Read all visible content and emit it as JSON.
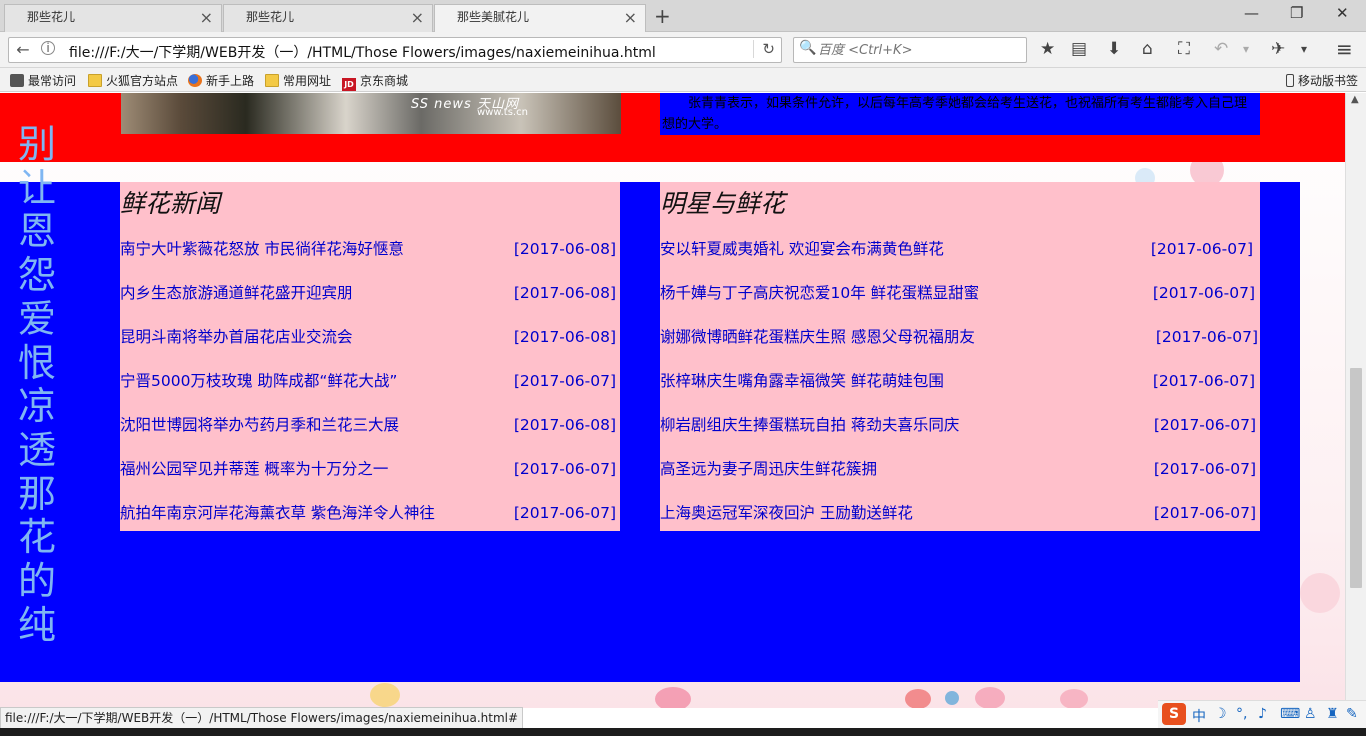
{
  "tabs": [
    {
      "title": "那些花儿",
      "close": "×"
    },
    {
      "title": "那些花儿",
      "close": "×"
    },
    {
      "title": "那些美腻花儿",
      "close": "×"
    }
  ],
  "newtab": "+",
  "window": {
    "minimize": "—",
    "restore": "❐",
    "close": "✕"
  },
  "nav": {
    "back": "←",
    "info": "i",
    "url": "file:///F:/大一/下学期/WEB开发（一）/HTML/Those Flowers/images/naxiemeinihua.html",
    "reload": "↻",
    "search_placeholder": "百度 <Ctrl+K>",
    "search_icon": "🔍"
  },
  "toolbar_icons": [
    "★",
    "▤",
    "⬇",
    "⌂",
    "⛶",
    "↶",
    "▾",
    "✈",
    "▾",
    "≡"
  ],
  "bookmarks": [
    {
      "label": "最常访问",
      "icon": "gear-icon"
    },
    {
      "label": "火狐官方站点",
      "icon": "folder-icon"
    },
    {
      "label": "新手上路",
      "icon": "firefox-icon"
    },
    {
      "label": "常用网址",
      "icon": "folder-icon"
    },
    {
      "label": "京东商城",
      "icon": "jd-icon"
    }
  ],
  "jd_badge": "JD",
  "mobile_bookmarks": "移动版书签",
  "page": {
    "banner_logo": "SS news 天山网",
    "banner_site": "www.ts.cn",
    "top_paragraph": "张青青表示，如果条件允许，以后每年高考季她都会给考生送花，也祝福所有考生都能考入自己理想的大学。",
    "vertical_text": "别让恩怨爱恨 凉透那花的纯",
    "left_panel": {
      "title": "鲜花新闻",
      "items": [
        {
          "text": "南宁大叶紫薇花怒放  市民徜徉花海好惬意",
          "date": "[2017-06-08]"
        },
        {
          "text": "内乡生态旅游通道鲜花盛开迎宾朋",
          "date": "[2017-06-08]"
        },
        {
          "text": "昆明斗南将举办首届花店业交流会",
          "date": "[2017-06-08]"
        },
        {
          "text": "宁晋5000万枝玫瑰  助阵成都“鲜花大战”",
          "date": "[2017-06-07]"
        },
        {
          "text": "沈阳世博园将举办芍药月季和兰花三大展",
          "date": "[2017-06-08]"
        },
        {
          "text": "福州公园罕见并蒂莲  概率为十万分之一",
          "date": "[2017-06-07]"
        },
        {
          "text": "航拍年南京河岸花海薰衣草  紫色海洋令人神往",
          "date": "[2017-06-07]"
        }
      ]
    },
    "right_panel": {
      "title": "明星与鲜花",
      "items": [
        {
          "text": "安以轩夏威夷婚礼  欢迎宴会布满黄色鲜花",
          "date": "[2017-06-07]"
        },
        {
          "text": "杨千嬅与丁子高庆祝恋爱10年  鲜花蛋糕显甜蜜",
          "date": "[2017-06-07]"
        },
        {
          "text": "谢娜微博晒鲜花蛋糕庆生照  感恩父母祝福朋友",
          "date": "[2017-06-07]"
        },
        {
          "text": "张梓琳庆生嘴角露幸福微笑  鲜花萌娃包围",
          "date": "[2017-06-07]"
        },
        {
          "text": "柳岩剧组庆生捧蛋糕玩自拍  蒋劲夫喜乐同庆",
          "date": "[2017-06-07]"
        },
        {
          "text": "高圣远为妻子周迅庆生鲜花簇拥",
          "date": "[2017-06-07]"
        },
        {
          "text": "上海奥运冠军深夜回沪  王励勤送鲜花",
          "date": "[2017-06-07]"
        }
      ]
    }
  },
  "scroll_up": "▲",
  "status_url": "file:///F:/大一/下学期/WEB开发（一）/HTML/Those Flowers/images/naxiemeinihua.html#",
  "ime": {
    "logo": "S",
    "lang": "中"
  }
}
